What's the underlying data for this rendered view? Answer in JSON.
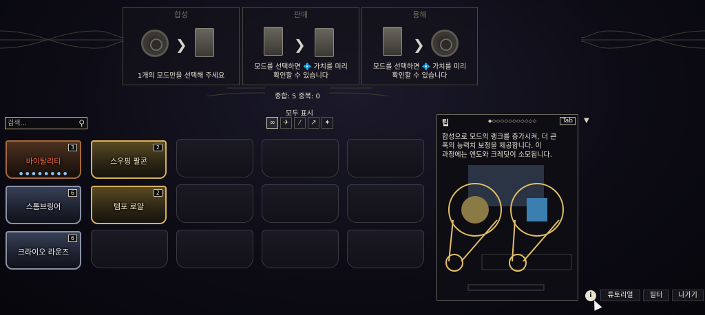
{
  "panels": {
    "fusion": {
      "title": "합성",
      "desc_line1": "1개의 모드만을 선택해 주세요",
      "desc_line2": ""
    },
    "sell": {
      "title": "판매",
      "desc_line1": "모드를 선택하면 💠 가치를 미리",
      "desc_line2": "확인할 수 있습니다"
    },
    "dissolve": {
      "title": "용해",
      "desc_line1": "모드를 선택하면 💠 가치를 미리",
      "desc_line2": "확인할 수 있습니다"
    }
  },
  "counts_text": "종합: 5  중복: 0",
  "show_all": "모두 표시",
  "search": {
    "placeholder": "검색..."
  },
  "filters": [
    {
      "icon": "infinity-icon",
      "glyph": "∞"
    },
    {
      "icon": "wings-icon",
      "glyph": "✈"
    },
    {
      "icon": "rifle-icon",
      "glyph": "⁄"
    },
    {
      "icon": "pistol-icon",
      "glyph": "↗"
    },
    {
      "icon": "melee-icon",
      "glyph": "✦"
    }
  ],
  "mods": [
    {
      "name": "바이탈리티",
      "badge": "3",
      "rarity": "bronze"
    },
    {
      "name": "스우핑 팔콘",
      "badge": "2",
      "rarity": "gold"
    },
    {
      "name": "스톰브링어",
      "badge": "6",
      "rarity": "silver"
    },
    {
      "name": "템포 로얄",
      "badge": "2",
      "rarity": "gold"
    },
    {
      "name": "크라이오 라운즈",
      "badge": "6",
      "rarity": "silver"
    }
  ],
  "tip": {
    "title": "팁",
    "pager": "◆◇◇◇◇◇◇◇◇◇◇◇",
    "tab_key": "Tab",
    "line1": "합성으로 모드의 랭크를 증가시켜, 더 큰",
    "line2": "폭의 능력치 보정을 제공합니다. 이",
    "line3": "과정에는 엔도와 크레딧이 소모됩니다."
  },
  "footer": {
    "tutorial": "튜토리얼",
    "filter": "필터",
    "exit": "나가기"
  },
  "colors": {
    "accent_gold": "#d8b25a",
    "bronze": "#a66a36",
    "silver": "#8a92a6",
    "bronze_name": "#ff6a4a"
  }
}
